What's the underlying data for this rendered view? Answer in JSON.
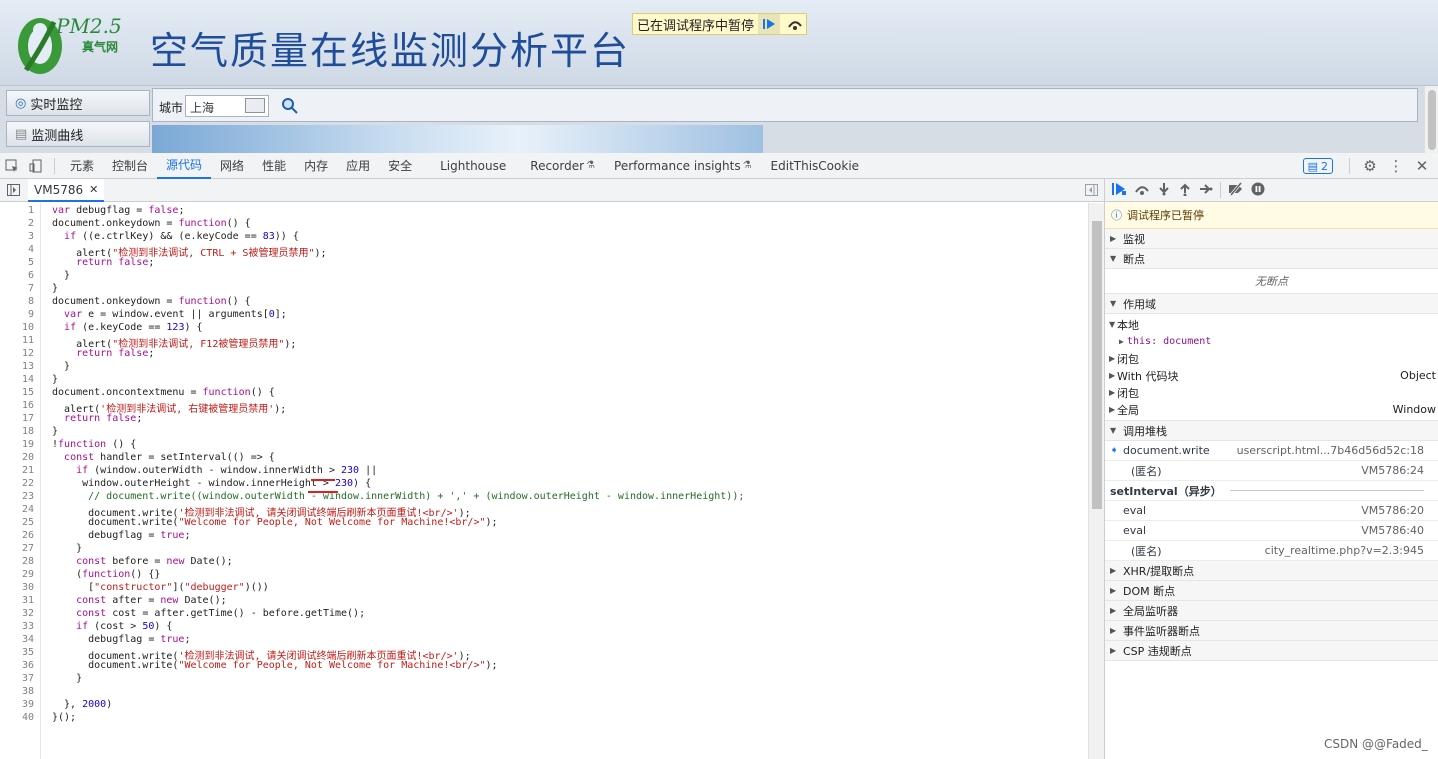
{
  "site": {
    "logo_text": "PM2.5",
    "logo_sub": "真气网",
    "title": "空气质量在线监测分析平台",
    "nav": [
      "实时监控",
      "监测曲线"
    ],
    "city_label": "城市",
    "city_value": "上海",
    "paused_text": "已在调试程序中暂停"
  },
  "devtools": {
    "tabs": [
      "元素",
      "控制台",
      "源代码",
      "网络",
      "性能",
      "内存",
      "应用",
      "安全",
      "Lighthouse",
      "Recorder",
      "Performance insights",
      "EditThisCookie"
    ],
    "active_tab": "源代码",
    "issues_count": "2",
    "file_tab": "VM5786",
    "code_lines": [
      "var debugflag = false;",
      "document.onkeydown = function() {",
      "  if ((e.ctrlKey) && (e.keyCode == 83)) {",
      "    alert(\"检测到非法调试, CTRL + S被管理员禁用\");",
      "    return false;",
      "  }",
      "}",
      "document.onkeydown = function() {",
      "  var e = window.event || arguments[0];",
      "  if (e.keyCode == 123) {",
      "    alert(\"检测到非法调试, F12被管理员禁用\");",
      "    return false;",
      "  }",
      "}",
      "document.oncontextmenu = function() {",
      "  alert('检测到非法调试, 右键被管理员禁用');",
      "  return false;",
      "}",
      "!function () {",
      "  const handler = setInterval(() => {",
      "    if (window.outerWidth - window.innerWidth > 230 ||",
      "     window.outerHeight - window.innerHeight > 230) {",
      "      // document.write((window.outerWidth - window.innerWidth) + ',' + (window.outerHeight - window.innerHeight));",
      "      document.write('检测到非法调试, 请关闭调试终端后刷新本页面重试!<br/>');",
      "      document.write(\"Welcome for People, Not Welcome for Machine!<br/>\");",
      "      debugflag = true;",
      "    }",
      "    const before = new Date();",
      "    (function() {}",
      "      [\"constructor\"](\"debugger\")())",
      "    const after = new Date();",
      "    const cost = after.getTime() - before.getTime();",
      "    if (cost > 50) {",
      "      debugflag = true;",
      "      document.write('检测到非法调试, 请关闭调试终端后刷新本页面重试!<br/>');",
      "      document.write(\"Welcome for People, Not Welcome for Machine!<br/>\");",
      "    }",
      "",
      "  }, 2000)",
      "}();"
    ],
    "right": {
      "paused": "调试程序已暂停",
      "watch": "监视",
      "breakpoints": "断点",
      "no_breakpoints": "无断点",
      "scope": "作用域",
      "local": "本地",
      "this_label": "this: document",
      "closure1": "闭包",
      "with_block": "With 代码块",
      "with_value": "Object",
      "closure2": "闭包",
      "global": "全局",
      "global_value": "Window",
      "callstack": "调用堆栈",
      "frames": [
        {
          "name": "document.write",
          "loc": "userscript.html...7b46d56d52c:18"
        },
        {
          "name": "(匿名)",
          "loc": "VM5786:24"
        },
        {
          "name": "setInterval（异步）",
          "loc": ""
        },
        {
          "name": "eval",
          "loc": "VM5786:20"
        },
        {
          "name": "eval",
          "loc": "VM5786:40"
        },
        {
          "name": "(匿名)",
          "loc": "city_realtime.php?v=2.3:945"
        }
      ],
      "xhr": "XHR/提取断点",
      "dom": "DOM 断点",
      "global_listeners": "全局监听器",
      "event_listeners": "事件监听器断点",
      "csp": "CSP 违规断点"
    }
  },
  "watermark": "CSDN @@Faded_"
}
